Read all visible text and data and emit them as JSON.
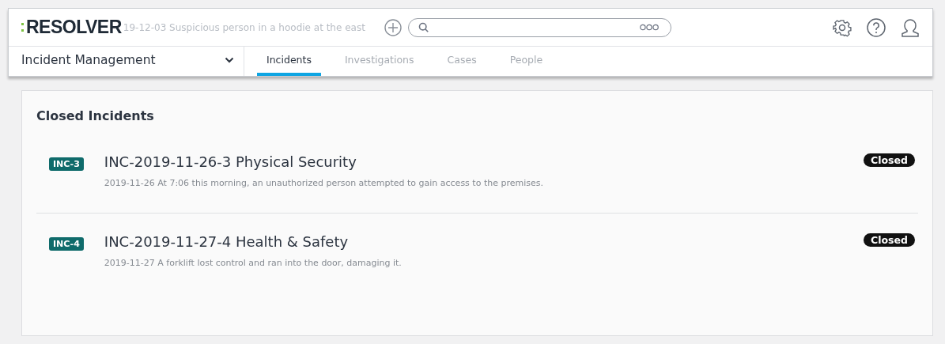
{
  "header": {
    "logo": "RESOLVER",
    "ghost_text": "19-12-03 Suspicious person in a hoodie at the east"
  },
  "nav": {
    "app": "Incident Management",
    "tabs": [
      {
        "label": "Incidents",
        "selected": true
      },
      {
        "label": "Investigations",
        "selected": false
      },
      {
        "label": "Cases",
        "selected": false
      },
      {
        "label": "People",
        "selected": false
      }
    ]
  },
  "card": {
    "title": "Closed Incidents",
    "items": [
      {
        "badge": "INC-3",
        "title": "INC-2019-11-26-3 Physical Security",
        "description": "2019-11-26 At 7:06 this morning, an unauthorized person attempted to gain access to the premises.",
        "status": "Closed"
      },
      {
        "badge": "INC-4",
        "title": "INC-2019-11-27-4 Health & Safety",
        "description": "2019-11-27 A forklift lost control and ran into the door, damaging it.",
        "status": "Closed"
      }
    ]
  }
}
